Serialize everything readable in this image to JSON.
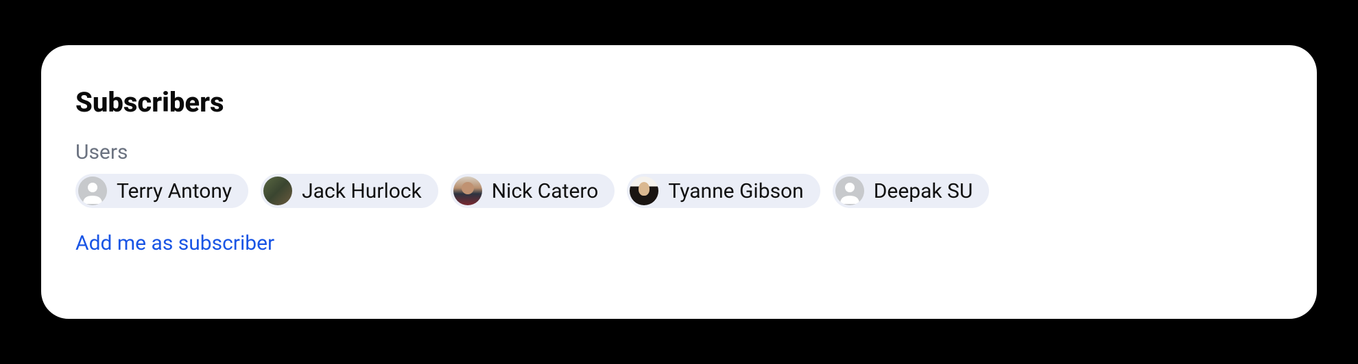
{
  "section": {
    "title": "Subscribers",
    "users_label": "Users",
    "add_link": "Add me as subscriber"
  },
  "subscribers": [
    {
      "name": "Terry Antony",
      "avatar_type": "placeholder"
    },
    {
      "name": "Jack Hurlock",
      "avatar_type": "photo"
    },
    {
      "name": "Nick Catero",
      "avatar_type": "photo"
    },
    {
      "name": "Tyanne Gibson",
      "avatar_type": "photo"
    },
    {
      "name": "Deepak SU",
      "avatar_type": "placeholder"
    }
  ]
}
